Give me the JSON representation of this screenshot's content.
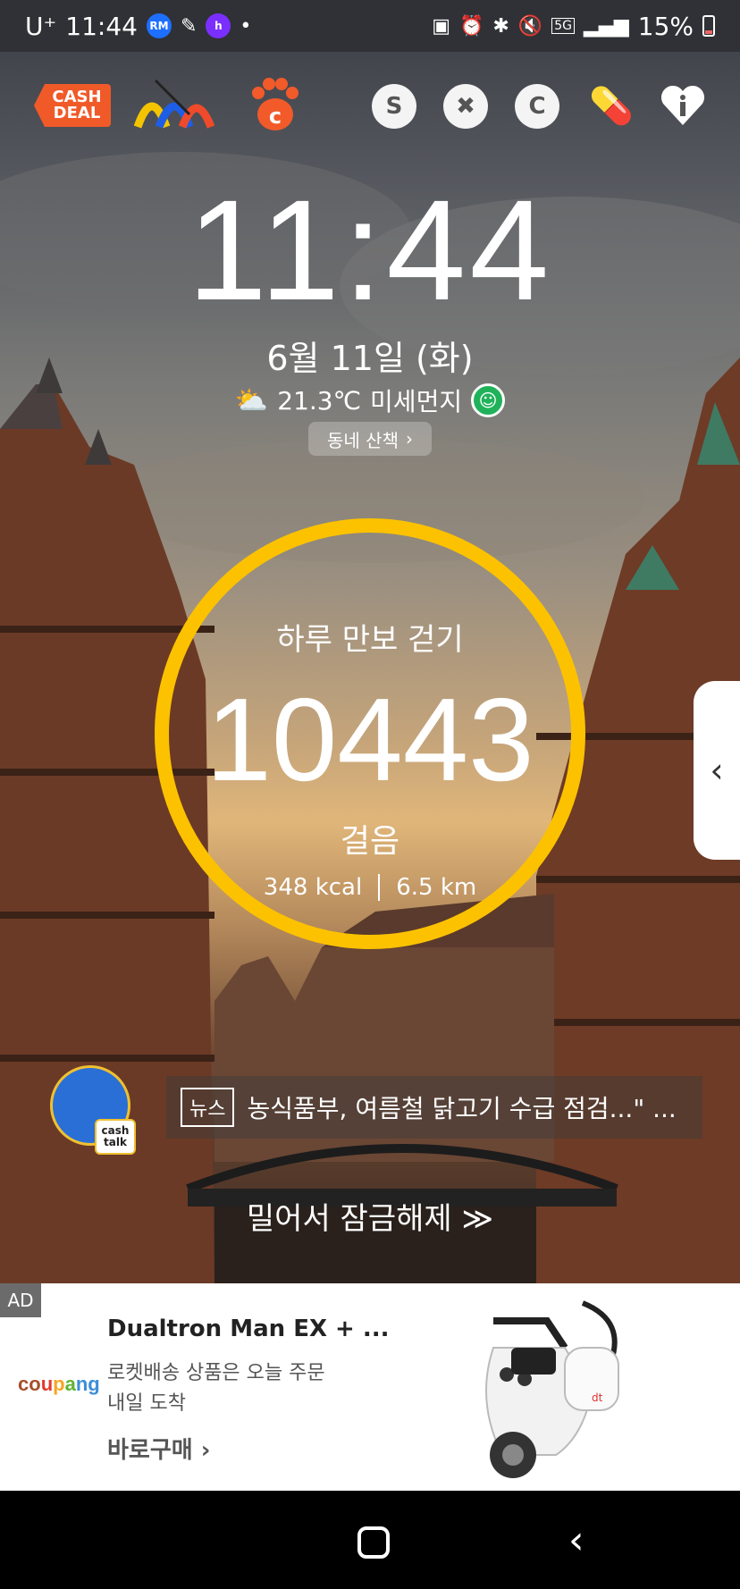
{
  "status_bar": {
    "carrier": "U⁺",
    "time": "11:44",
    "battery": "15%",
    "network": "5G"
  },
  "shortcuts": {
    "cashdeal_line1": "CASH",
    "cashdeal_line2": "DEAL"
  },
  "clock": {
    "time": "11:44"
  },
  "date": "6월 11일 (화)",
  "weather": {
    "temperature": "21.3℃",
    "dust_label": "미세먼지"
  },
  "walk_pill": {
    "label": "동네 산책",
    "chevron": "›"
  },
  "step_widget": {
    "title": "하루 만보 걷기",
    "steps": "10443",
    "unit": "걸음",
    "kcal": "348 kcal",
    "distance": "6.5 km"
  },
  "side_handle": {
    "icon": "‹"
  },
  "cashtalk": {
    "tag_line1": "cash",
    "tag_line2": "talk"
  },
  "news": {
    "tag": "뉴스",
    "headline": "농식품부, 여름철 닭고기 수급 점검...\" ..."
  },
  "unlock_text": "밀어서 잠금해제 ≫",
  "ad": {
    "label": "AD",
    "brand": "coupang",
    "title": "Dualtron Man EX + ...",
    "desc_line1": "로켓배송 상품은 오늘 주문",
    "desc_line2": "내일 도착",
    "cta": "바로구매 ›"
  },
  "colors": {
    "ring": "#fcc200",
    "cashdeal": "#f05a28",
    "dust_good": "#1fb25a"
  }
}
